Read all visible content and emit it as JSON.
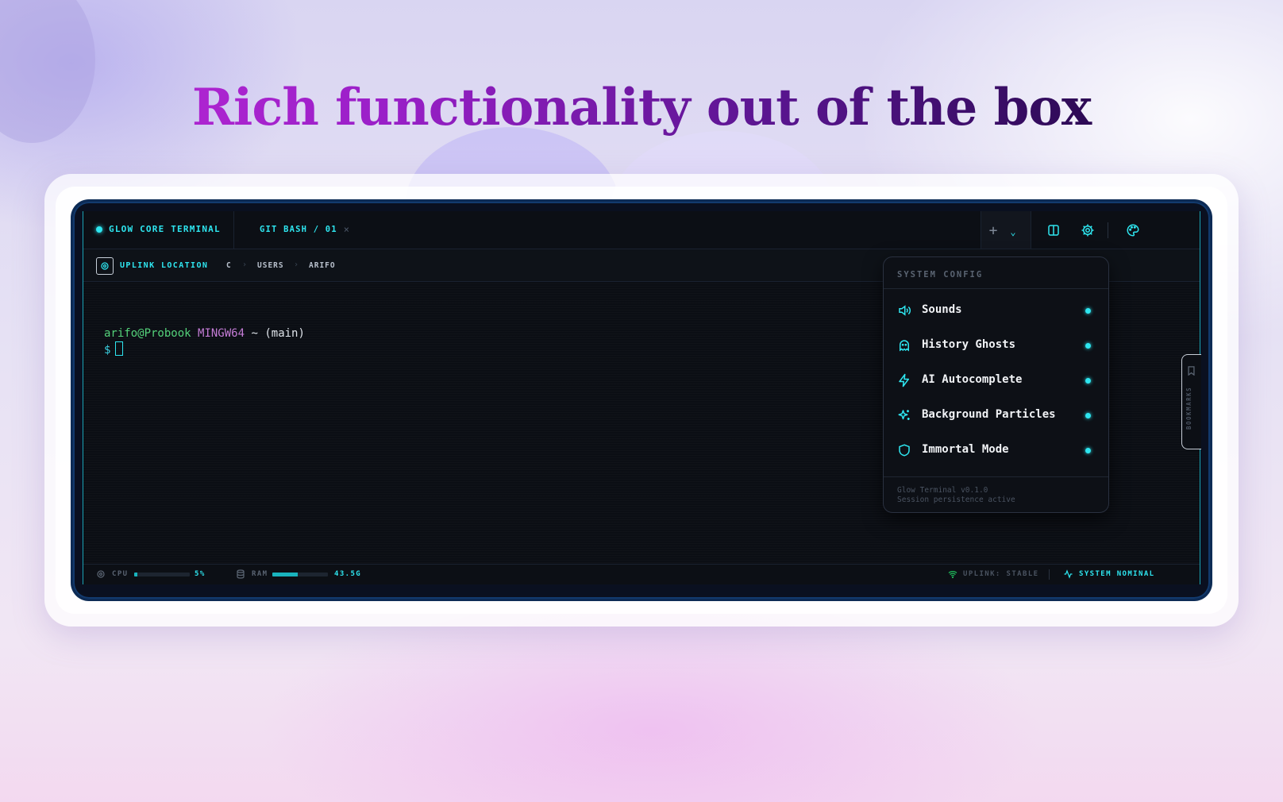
{
  "headline": "Rich functionality out of the box",
  "colors": {
    "accent": "#2ee6f0",
    "user": "#54d27a",
    "host_system": "#c47cd6",
    "panel_bg": "#0d1016"
  },
  "terminal": {
    "brand": "GLOW CORE TERMINAL",
    "tab": {
      "label": "GIT BASH / 01",
      "close": "×"
    },
    "toolbar": {
      "new_tab": "+",
      "new_tab_menu": "⌄",
      "split_icon": "split-view-icon",
      "settings_icon": "gear-icon",
      "theme_icon": "palette-icon"
    },
    "path": {
      "label": "UPLINK LOCATION",
      "crumbs": [
        "C",
        "USERS",
        "ARIFO"
      ],
      "separator": "›"
    },
    "prompt": {
      "user_host": "arifo@Probook",
      "system": "MINGW64",
      "cwd": "~",
      "branch": "(main)",
      "symbol": "$"
    },
    "config_panel": {
      "title": "SYSTEM CONFIG",
      "options": [
        {
          "label": "Sounds",
          "icon": "speaker-icon",
          "enabled": true
        },
        {
          "label": "History Ghosts",
          "icon": "ghost-icon",
          "enabled": true
        },
        {
          "label": "AI Autocomplete",
          "icon": "lightning-icon",
          "enabled": true
        },
        {
          "label": "Background Particles",
          "icon": "sparkles-icon",
          "enabled": true
        },
        {
          "label": "Immortal Mode",
          "icon": "shield-icon",
          "enabled": true
        }
      ],
      "footer_version": "Glow Terminal v0.1.0",
      "footer_status": "Session persistence active"
    },
    "bookmarks": {
      "label": "BOOKMARKS",
      "icon": "bookmark-icon"
    },
    "status": {
      "cpu_label": "CPU",
      "cpu_value": "5%",
      "cpu_fraction": 0.05,
      "ram_label": "RAM",
      "ram_value": "43.5G",
      "ram_fraction": 0.45,
      "uplink": "UPLINK: STABLE",
      "system": "SYSTEM NOMINAL"
    }
  }
}
